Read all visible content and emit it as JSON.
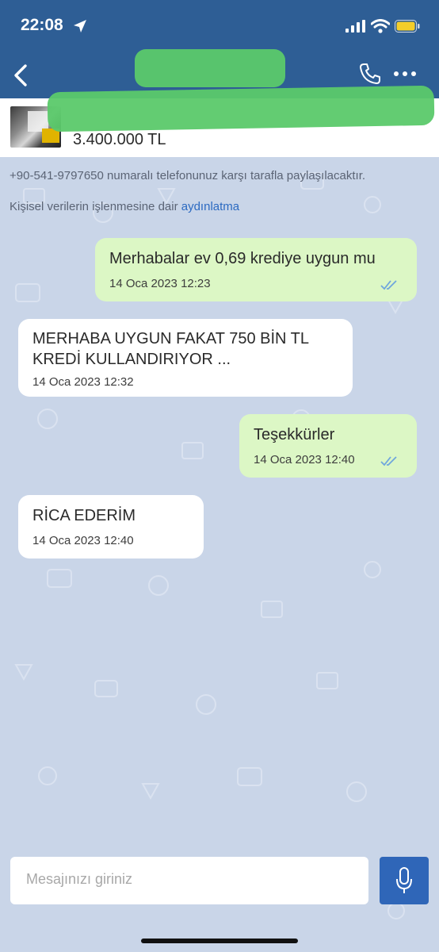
{
  "status_bar": {
    "time": "22:08"
  },
  "header": {
    "back_icon": "chevron-left-icon",
    "call_icon": "phone-icon",
    "more_icon": "more-dots-icon"
  },
  "listing": {
    "price": "3.400.000 TL"
  },
  "notices": {
    "phone_share": "+90-541-9797650 numaralı telefonunuz karşı tarafla paylaşılacaktır.",
    "kvkk_prefix": "Kişisel verilerin işlenmesine dair ",
    "kvkk_link": "aydınlatma"
  },
  "messages": [
    {
      "direction": "out",
      "text": "Merhabalar ev 0,69 krediye uygun mu",
      "time": "14 Oca 2023 12:23",
      "read": true
    },
    {
      "direction": "in",
      "text_line1": "MERHABA UYGUN FAKAT 750 BİN TL",
      "text_line2": "KREDİ KULLANDIRIYOR ...",
      "time": "14 Oca 2023 12:32"
    },
    {
      "direction": "out",
      "text": "Teşekkürler",
      "time": "14 Oca 2023 12:40",
      "read": true
    },
    {
      "direction": "in",
      "text": "RİCA EDERİM",
      "time": "14 Oca 2023 12:40"
    }
  ],
  "composer": {
    "placeholder": "Mesajınızı giriniz",
    "mic_icon": "microphone-icon"
  },
  "colors": {
    "header_bg": "#2e5e95",
    "chat_bg": "#c9d5e8",
    "outgoing_bubble": "#dcf7c5",
    "incoming_bubble": "#ffffff",
    "link": "#2c6ac1",
    "mic_button": "#2f66b8"
  }
}
